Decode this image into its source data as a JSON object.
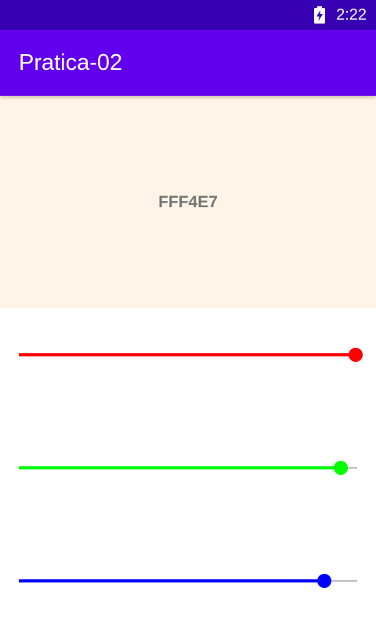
{
  "status_bar": {
    "time": "2:22",
    "battery_icon": "battery-charging-icon"
  },
  "app_bar": {
    "title": "Pratica-02"
  },
  "preview": {
    "hex_label": "FFF4E7",
    "background_color": "#fff4e7"
  },
  "colors": {
    "status_bar": "#3700b3",
    "app_bar": "#6200ee"
  },
  "sliders": [
    {
      "name": "red",
      "color": "#ff0000",
      "value": 255,
      "max": 255
    },
    {
      "name": "green",
      "color": "#00ff00",
      "value": 244,
      "max": 255
    },
    {
      "name": "blue",
      "color": "#0000ff",
      "value": 231,
      "max": 255
    }
  ]
}
